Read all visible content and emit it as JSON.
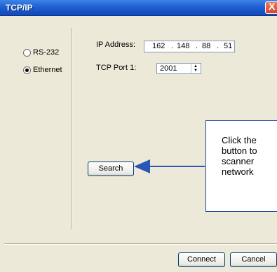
{
  "window": {
    "title": "TCP/IP",
    "close_glyph": "X"
  },
  "connection": {
    "options": [
      {
        "label": "RS-232",
        "selected": false
      },
      {
        "label": "Ethernet",
        "selected": true
      }
    ]
  },
  "settings": {
    "ip_label": "IP Address:",
    "ip_segments": [
      "162",
      "148",
      "88",
      "51"
    ],
    "ip_dot": ".",
    "port_label": "TCP Port 1:",
    "port_value": "2001"
  },
  "buttons": {
    "search": "Search",
    "connect": "Connect",
    "cancel": "Cancel"
  },
  "callout": {
    "lines": [
      "Click the",
      "button to",
      "scanner",
      "network"
    ]
  },
  "colors": {
    "titlebar": "#1f5fd1",
    "arrow": "#2b56b8",
    "background": "#ece9d8"
  }
}
